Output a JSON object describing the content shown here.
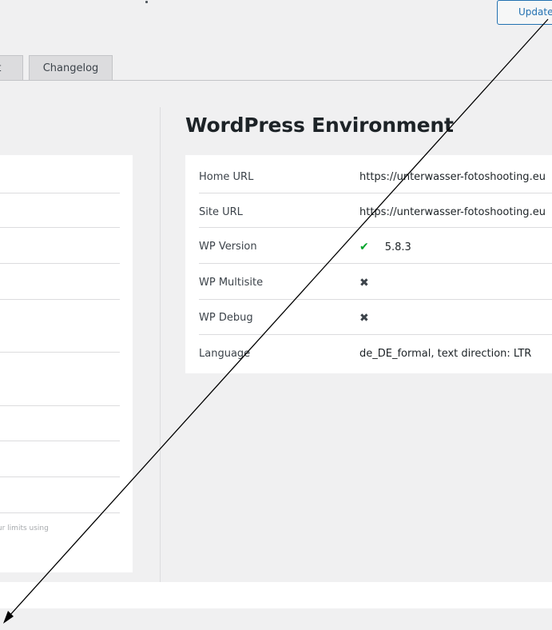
{
  "header": {
    "update_button_label": "Update"
  },
  "tabs": [
    {
      "label": "rt"
    },
    {
      "label": "Changelog"
    }
  ],
  "left_panel": {
    "note_fragment": "k your limits using"
  },
  "wp_env": {
    "title": "WordPress Environment",
    "rows": [
      {
        "label": "Home URL",
        "value": "https://unterwasser-fotoshooting.eu"
      },
      {
        "label": "Site URL",
        "value": "https://unterwasser-fotoshooting.eu"
      },
      {
        "label": "WP Version",
        "value": "5.8.3",
        "icon": "check-icon"
      },
      {
        "label": "WP Multisite",
        "icon": "x-icon"
      },
      {
        "label": "WP Debug",
        "icon": "x-icon"
      },
      {
        "label": "Language",
        "value": "de_DE_formal, text direction: LTR"
      }
    ]
  },
  "colors": {
    "accent": "#2271b1",
    "success": "#00a32a",
    "background": "#f0f0f1"
  }
}
